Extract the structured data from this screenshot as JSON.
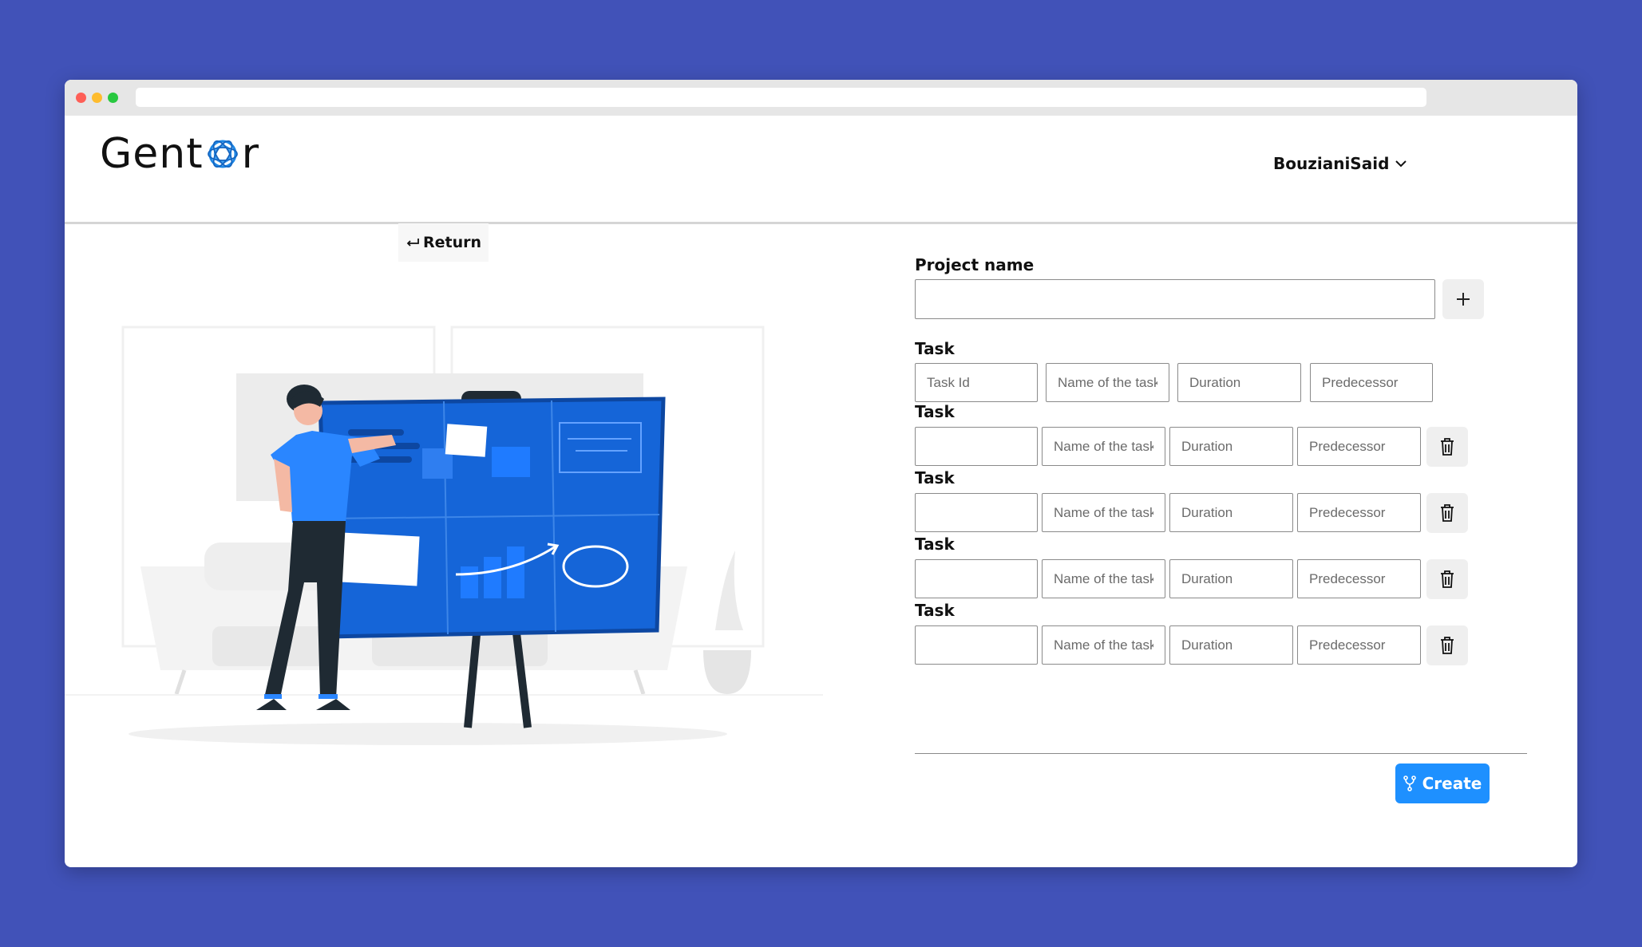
{
  "app": {
    "logo_text_left": "Gent",
    "logo_text_right": "r"
  },
  "header": {
    "user_name": "BouzianiSaid"
  },
  "nav": {
    "return_label": "Return"
  },
  "form": {
    "project_label": "Project name",
    "project_value": "",
    "add_button_icon": "plus-icon",
    "task_label": "Task",
    "tasks": [
      {
        "id_placeholder": "Task Id",
        "name_placeholder": "Name of the task",
        "duration_placeholder": "Duration",
        "predecessor_placeholder": "Predecessor"
      },
      {
        "id_placeholder": "",
        "name_placeholder": "Name of the task",
        "duration_placeholder": "Duration",
        "predecessor_placeholder": "Predecessor"
      },
      {
        "id_placeholder": "",
        "name_placeholder": "Name of the task",
        "duration_placeholder": "Duration",
        "predecessor_placeholder": "Predecessor"
      },
      {
        "id_placeholder": "",
        "name_placeholder": "Name of the task",
        "duration_placeholder": "Duration",
        "predecessor_placeholder": "Predecessor"
      },
      {
        "id_placeholder": "",
        "name_placeholder": "Name of the task",
        "duration_placeholder": "Duration",
        "predecessor_placeholder": "Predecessor"
      }
    ],
    "create_label": "Create"
  },
  "colors": {
    "background": "#4152b8",
    "accent": "#1e90ff",
    "board": "#1565d8"
  }
}
